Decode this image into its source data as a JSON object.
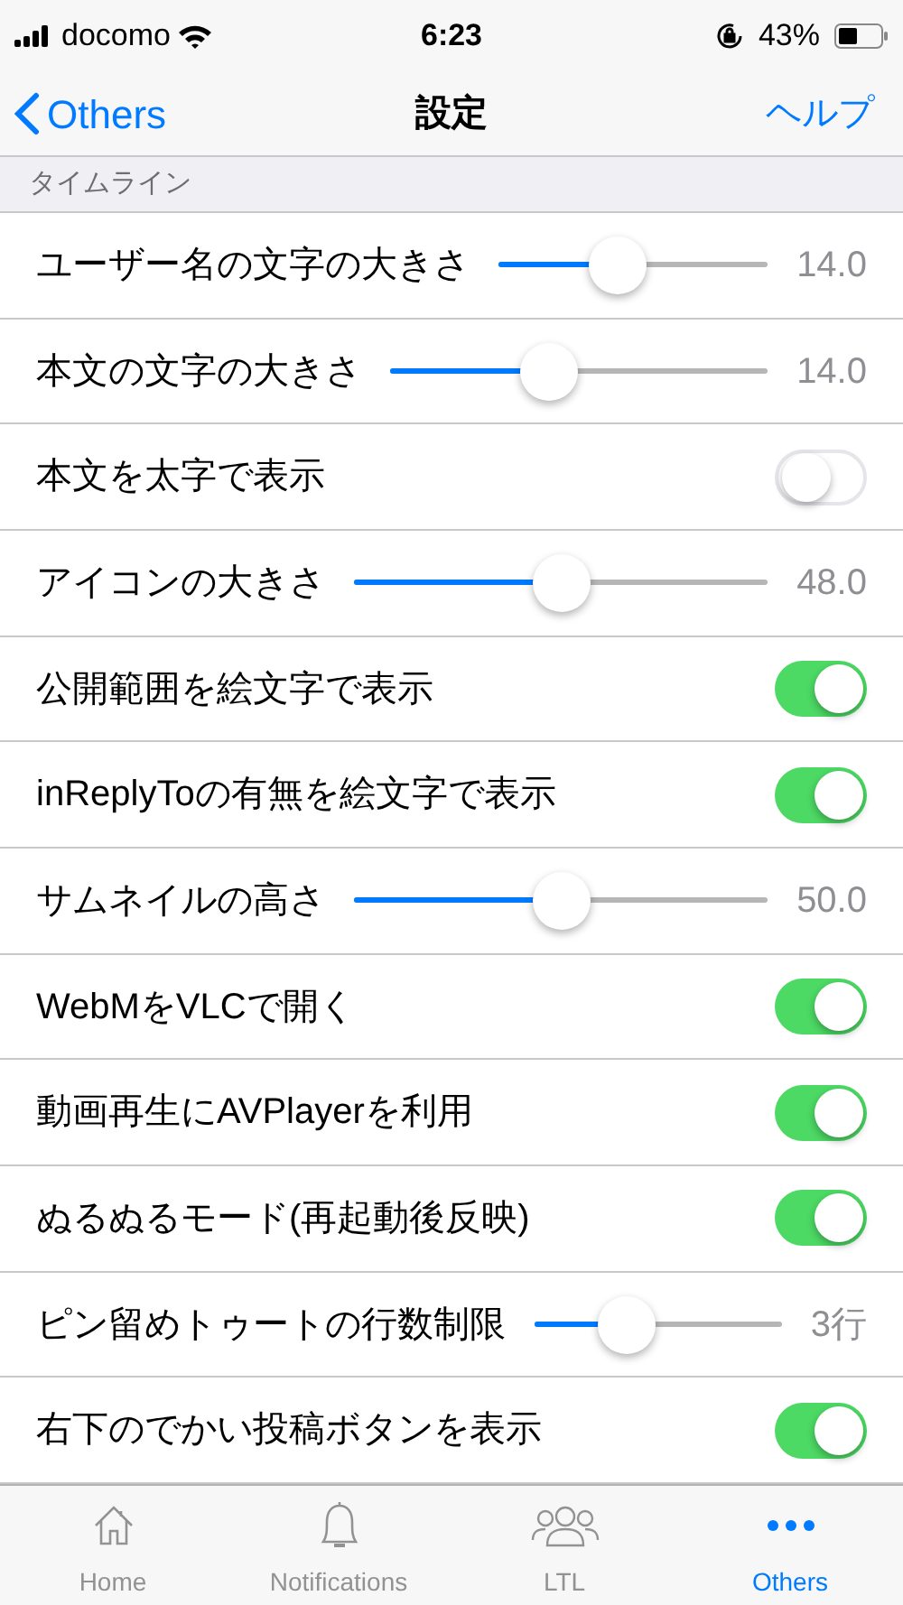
{
  "status_bar": {
    "carrier": "docomo",
    "time": "6:23",
    "battery": "43%"
  },
  "nav": {
    "back": "Others",
    "title": "設定",
    "action": "ヘルプ"
  },
  "section": {
    "title": "タイムライン"
  },
  "rows": [
    {
      "kind": "slider",
      "label": "ユーザー名の文字の大きさ",
      "level": 0.44,
      "reading": "14.0"
    },
    {
      "kind": "slider",
      "label": "本文の文字の大きさ",
      "level": 0.42,
      "reading": "14.0"
    },
    {
      "kind": "switch",
      "label": "本文を太字で表示",
      "on": false
    },
    {
      "kind": "slider",
      "label": "アイコンの大きさ",
      "level": 0.5,
      "reading": "48.0"
    },
    {
      "kind": "switch",
      "label": "公開範囲を絵文字で表示",
      "on": true
    },
    {
      "kind": "switch",
      "label": "inReplyToの有無を絵文字で表示",
      "on": true
    },
    {
      "kind": "slider",
      "label": "サムネイルの高さ",
      "level": 0.5,
      "reading": "50.0"
    },
    {
      "kind": "switch",
      "label": "WebMをVLCで開く",
      "on": true
    },
    {
      "kind": "switch",
      "label": "動画再生にAVPlayerを利用",
      "on": true
    },
    {
      "kind": "switch",
      "label": "ぬるぬるモード(再起動後反映)",
      "on": true
    },
    {
      "kind": "slider",
      "label": "ピン留めトゥートの行数制限",
      "level": 0.37,
      "reading": "3行"
    },
    {
      "kind": "switch",
      "label": "右下のでかい投稿ボタンを表示",
      "on": true
    }
  ],
  "tabs": [
    {
      "kind": "home",
      "label": "Home",
      "selected": false
    },
    {
      "kind": "bell",
      "label": "Notifications",
      "selected": false
    },
    {
      "kind": "people",
      "label": "LTL",
      "selected": false
    },
    {
      "kind": "more",
      "label": "Others",
      "selected": true
    }
  ]
}
